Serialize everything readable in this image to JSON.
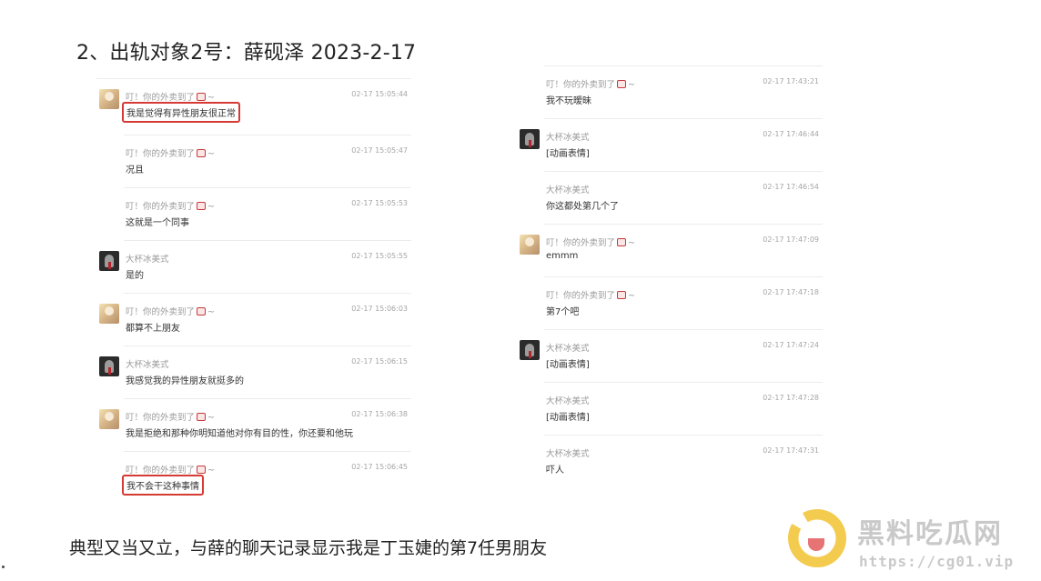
{
  "heading": "2、出轨对象2号：薛砚泽 2023-2-17",
  "left_messages": [
    {
      "sender": "叮！你的外卖到了",
      "suffix": "~",
      "time": "02-17 15:05:44",
      "text": "我是觉得有异性朋友很正常",
      "avatar": "girl",
      "highlight": true
    },
    {
      "sender": "叮！你的外卖到了",
      "suffix": "~",
      "time": "02-17 15:05:47",
      "text": "况且",
      "avatar": "none",
      "highlight": false
    },
    {
      "sender": "叮！你的外卖到了",
      "suffix": "~",
      "time": "02-17 15:05:53",
      "text": "这就是一个同事",
      "avatar": "none",
      "highlight": false
    },
    {
      "sender": "大杯冰美式",
      "suffix": "",
      "time": "02-17 15:05:55",
      "text": "是的",
      "avatar": "boy",
      "highlight": false
    },
    {
      "sender": "叮！你的外卖到了",
      "suffix": "~",
      "time": "02-17 15:06:03",
      "text": "都算不上朋友",
      "avatar": "girl",
      "highlight": false
    },
    {
      "sender": "大杯冰美式",
      "suffix": "",
      "time": "02-17 15:06:15",
      "text": "我感觉我的异性朋友就挺多的",
      "avatar": "boy",
      "highlight": false
    },
    {
      "sender": "叮！你的外卖到了",
      "suffix": "~",
      "time": "02-17 15:06:38",
      "text": "我是拒绝和那种你明知道他对你有目的性，你还要和他玩",
      "avatar": "girl",
      "highlight": false
    },
    {
      "sender": "叮！你的外卖到了",
      "suffix": "~",
      "time": "02-17 15:06:45",
      "text": "我不会干这种事情",
      "avatar": "none",
      "highlight": true
    }
  ],
  "right_messages": [
    {
      "sender": "叮！你的外卖到了",
      "suffix": "~",
      "time": "02-17 17:43:21",
      "text": "我不玩暧昧",
      "avatar": "none",
      "highlight": false
    },
    {
      "sender": "大杯冰美式",
      "suffix": "",
      "time": "02-17 17:46:44",
      "text": "[动画表情]",
      "avatar": "boy",
      "highlight": false
    },
    {
      "sender": "大杯冰美式",
      "suffix": "",
      "time": "02-17 17:46:54",
      "text": "你这都处第几个了",
      "avatar": "none",
      "highlight": false
    },
    {
      "sender": "叮！你的外卖到了",
      "suffix": "~",
      "time": "02-17 17:47:09",
      "text": "emmm",
      "avatar": "girl",
      "highlight": false
    },
    {
      "sender": "叮！你的外卖到了",
      "suffix": "~",
      "time": "02-17 17:47:18",
      "text": "第7个吧",
      "avatar": "none",
      "highlight": false
    },
    {
      "sender": "大杯冰美式",
      "suffix": "",
      "time": "02-17 17:47:24",
      "text": "[动画表情]",
      "avatar": "boy",
      "highlight": false
    },
    {
      "sender": "大杯冰美式",
      "suffix": "",
      "time": "02-17 17:47:28",
      "text": "[动画表情]",
      "avatar": "none",
      "highlight": false
    },
    {
      "sender": "大杯冰美式",
      "suffix": "",
      "time": "02-17 17:47:31",
      "text": "吓人",
      "avatar": "none",
      "highlight": false
    }
  ],
  "caption": "典型又当又立，与薛的聊天记录显示我是丁玉婕的第7任男朋友",
  "watermark": {
    "title": "黑料吃瓜网",
    "url": "https://cg01.vip"
  }
}
